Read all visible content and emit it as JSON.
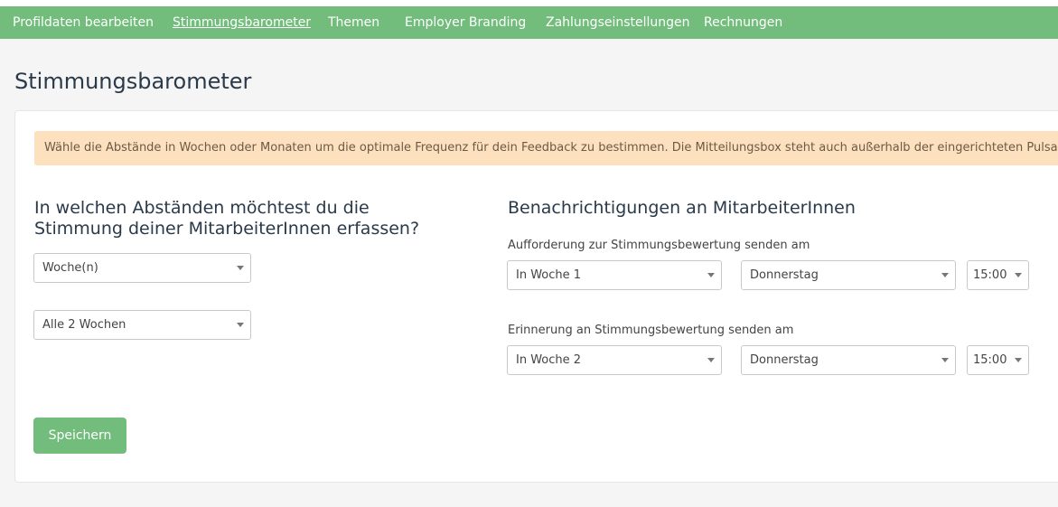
{
  "nav": {
    "items": [
      {
        "label": "Profildaten bearbeiten",
        "active": false
      },
      {
        "label": "Stimmungsbarometer",
        "active": true
      },
      {
        "label": "Themen",
        "active": false
      },
      {
        "label": "Employer Branding",
        "active": false
      },
      {
        "label": "Zahlungseinstellungen",
        "active": false
      },
      {
        "label": "Rechnungen",
        "active": false
      }
    ]
  },
  "page": {
    "title": "Stimmungsbarometer"
  },
  "info": {
    "text": "Wähle die Abstände in Wochen oder Monaten um die optimale Frequenz für dein Feedback zu bestimmen. Die Mitteilungsbox steht auch außerhalb der eingerichteten Pulsabfra"
  },
  "left": {
    "title": "In welchen Abständen möchtest du die Stimmung deiner MitarbeiterInnen erfassen?",
    "unit_select": {
      "value": "Woche(n)"
    },
    "interval_select": {
      "value": "Alle 2 Wochen"
    }
  },
  "right": {
    "title": "Benachrichtigungen an MitarbeiterInnen",
    "request": {
      "label": "Aufforderung zur Stimmungsbewertung senden am",
      "week": "In Woche 1",
      "day": "Donnerstag",
      "time": "15:00"
    },
    "reminder": {
      "label": "Erinnerung an Stimmungsbewertung senden am",
      "week": "In Woche 2",
      "day": "Donnerstag",
      "time": "15:00"
    }
  },
  "actions": {
    "save_label": "Speichern"
  },
  "colors": {
    "nav_background": "#72bc7c",
    "save_button": "#72bc7c",
    "info_background": "#fde1be",
    "title_text": "#2a3a4a"
  }
}
